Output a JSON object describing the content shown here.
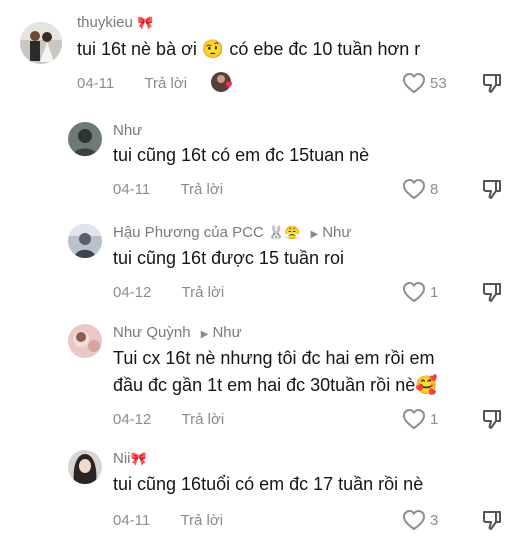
{
  "comments": [
    {
      "username": "thuykieu",
      "username_emoji": "🎀",
      "reply_to": "",
      "text": "tui 16t nè bà ơi",
      "text_emoji": "🤨",
      "text_tail": "có ebe đc 10 tuần hơn r",
      "date": "04-11",
      "reply_label": "Trả lời",
      "likes": "53"
    },
    {
      "username": "Như",
      "reply_to": "",
      "text": "tui cũng 16t có em đc 15tuan nè",
      "date": "04-11",
      "reply_label": "Trả lời",
      "likes": "8"
    },
    {
      "username": "Hậu Phương của PCC",
      "username_emoji": "🐰😤",
      "reply_to": "Như",
      "text": "tui cũng 16t được 15 tuần roi",
      "date": "04-12",
      "reply_label": "Trả lời",
      "likes": "1"
    },
    {
      "username": "Như Quỳnh",
      "reply_to": "Như",
      "text_line1": "Tui cx 16t nè nhưng tôi đc hai em rồi em",
      "text_line2": "đầu đc gần 1t em hai đc 30tuần rồi nè",
      "text_emoji": "🥰",
      "date": "04-12",
      "reply_label": "Trả lời",
      "likes": "1"
    },
    {
      "username": "Nii",
      "username_emoji": "🎀",
      "reply_to": "",
      "text": "tui cũng 16tuổi có em đc 17 tuần rồi nè",
      "date": "04-11",
      "reply_label": "Trả lời",
      "likes": "3"
    }
  ],
  "colors": {
    "text": "#161616",
    "muted": "#8e8e8e",
    "background": "#ffffff"
  }
}
